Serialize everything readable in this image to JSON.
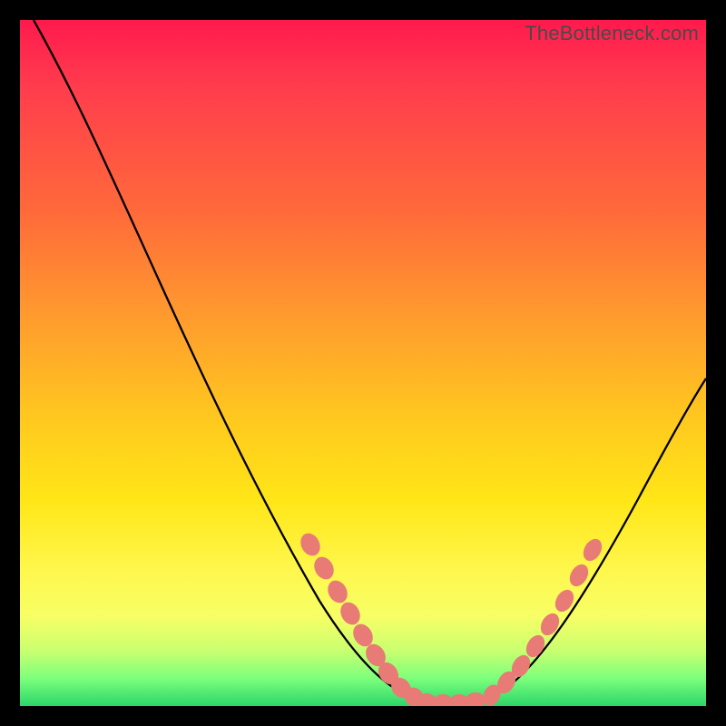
{
  "watermark": "TheBottleneck.com",
  "chart_data": {
    "type": "line",
    "title": "",
    "xlabel": "",
    "ylabel": "",
    "xlim": [
      0,
      100
    ],
    "ylim": [
      0,
      100
    ],
    "grid": false,
    "legend": false,
    "series": [
      {
        "name": "bottleneck-curve",
        "type": "line",
        "x": [
          2,
          10,
          20,
          30,
          40,
          48,
          55,
          60,
          65,
          72,
          80,
          90,
          100
        ],
        "y": [
          100,
          84,
          64,
          44,
          24,
          10,
          2,
          0,
          0,
          3,
          12,
          28,
          46
        ]
      },
      {
        "name": "bottleneck-markers-left",
        "type": "scatter",
        "x": [
          42,
          44,
          46,
          48,
          50,
          52,
          54,
          56,
          58,
          60,
          62
        ],
        "y": [
          23,
          19,
          15,
          11,
          8,
          5,
          3,
          1.5,
          0.8,
          0.4,
          0.3
        ]
      },
      {
        "name": "bottleneck-markers-floor",
        "type": "scatter",
        "x": [
          56,
          58,
          60,
          62,
          64,
          66
        ],
        "y": [
          0.3,
          0.3,
          0.3,
          0.3,
          0.3,
          0.3
        ]
      },
      {
        "name": "bottleneck-markers-right",
        "type": "scatter",
        "x": [
          68,
          70,
          72,
          74,
          76,
          78,
          80
        ],
        "y": [
          2,
          4,
          7,
          11,
          15,
          20,
          25
        ]
      }
    ],
    "annotations": [
      {
        "text": "TheBottleneck.com",
        "position": "top-right"
      }
    ],
    "gradient": {
      "direction": "vertical",
      "stops": [
        {
          "at": 0.0,
          "color": "#ff1a4d"
        },
        {
          "at": 0.45,
          "color": "#ffb020"
        },
        {
          "at": 0.8,
          "color": "#fff94c"
        },
        {
          "at": 1.0,
          "color": "#2bd66a"
        }
      ]
    }
  }
}
